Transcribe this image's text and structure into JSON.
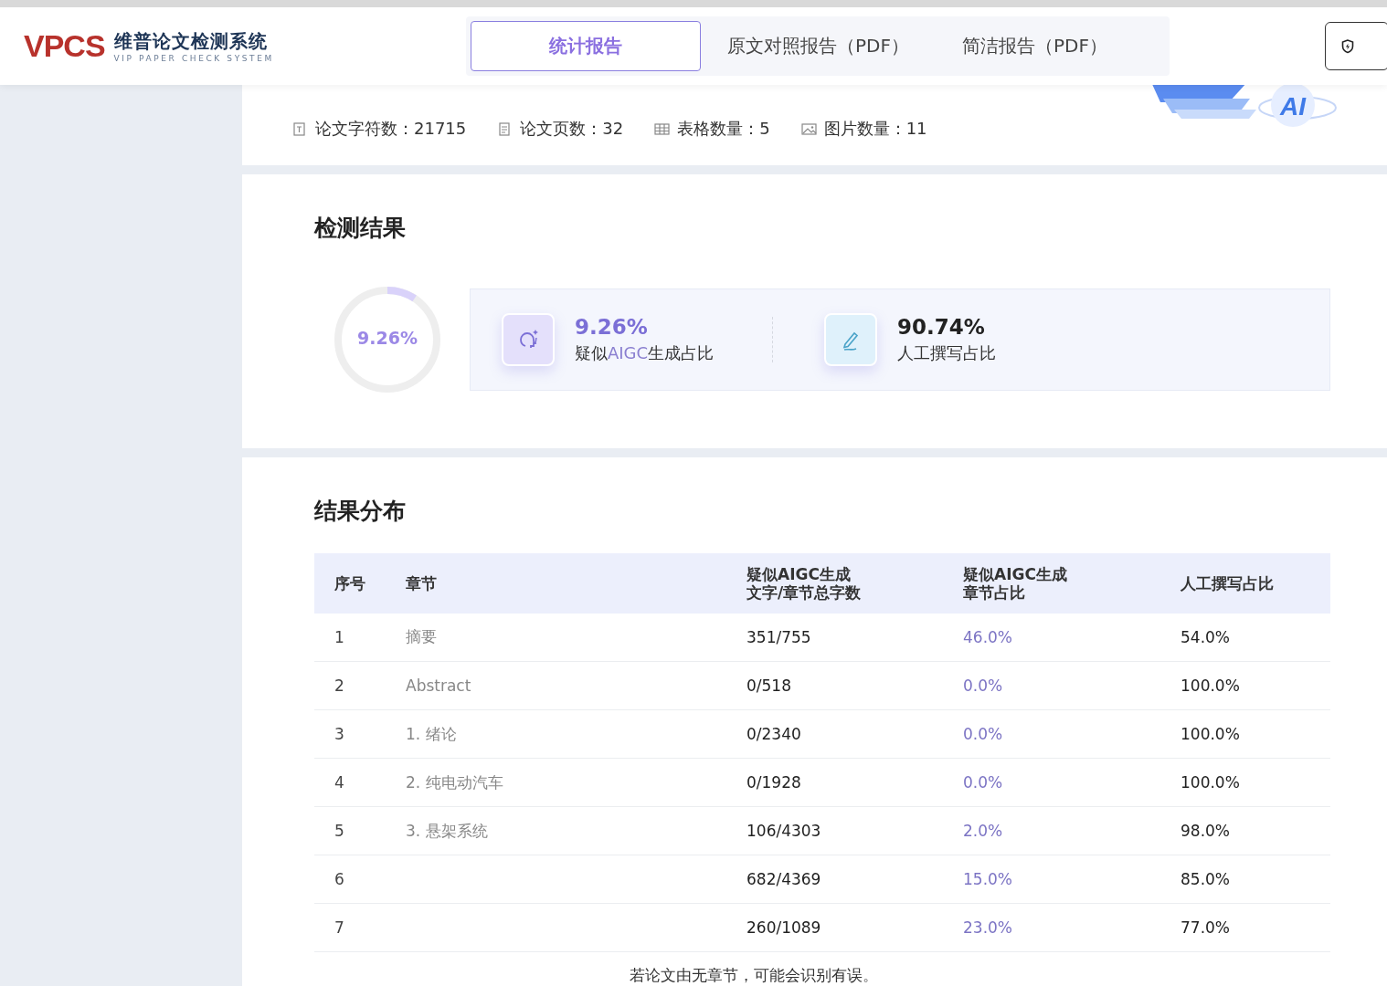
{
  "header": {
    "logo_mark": "VPCS",
    "logo_title": "维普论文检测系统",
    "logo_subtitle": "VIP PAPER CHECK SYSTEM",
    "tabs": [
      {
        "label": "统计报告",
        "selected": true
      },
      {
        "label": "原文对照报告（PDF）",
        "selected": false
      },
      {
        "label": "简洁报告（PDF）",
        "selected": false
      }
    ]
  },
  "paper_info": {
    "stats": [
      {
        "kind": "chars",
        "label": "论文字符数：",
        "value": "21715"
      },
      {
        "kind": "pages",
        "label": "论文页数：",
        "value": "32"
      },
      {
        "kind": "tables",
        "label": "表格数量：",
        "value": "5"
      },
      {
        "kind": "images",
        "label": "图片数量：",
        "value": "11"
      }
    ],
    "illustration_label": "AI"
  },
  "detection": {
    "title": "检测结果",
    "donut": {
      "label": "9.26%",
      "level": 0.0926
    },
    "metrics": [
      {
        "kind": "aigc",
        "value": "9.26%",
        "label": "疑似**AIGC**生成占比"
      },
      {
        "kind": "human",
        "value": "90.74%",
        "label": "人工撰写占比"
      }
    ]
  },
  "distribution": {
    "title": "结果分布",
    "columns": [
      {
        "lines": [
          "序号"
        ]
      },
      {
        "lines": [
          "章节"
        ]
      },
      {
        "lines": [
          "疑似AIGC生成",
          "文字/章节总字数"
        ]
      },
      {
        "lines": [
          "疑似AIGC生成",
          "章节占比"
        ]
      },
      {
        "lines": [
          "人工撰写占比"
        ]
      }
    ],
    "rows": [
      {
        "index": "1",
        "chapter": "摘要",
        "ratio": "351/755",
        "aigc": "46.0%",
        "human": "54.0%"
      },
      {
        "index": "2",
        "chapter": "Abstract",
        "ratio": "0/518",
        "aigc": "0.0%",
        "human": "100.0%"
      },
      {
        "index": "3",
        "chapter": "1. 绪论",
        "ratio": "0/2340",
        "aigc": "0.0%",
        "human": "100.0%"
      },
      {
        "index": "4",
        "chapter": "2. 纯电动汽车",
        "ratio": "0/1928",
        "aigc": "0.0%",
        "human": "100.0%"
      },
      {
        "index": "5",
        "chapter": "3. 悬架系统",
        "ratio": "106/4303",
        "aigc": "2.0%",
        "human": "98.0%"
      },
      {
        "index": "6",
        "ratio": "682/4369",
        "aigc": "15.0%",
        "human": "85.0%"
      },
      {
        "index": "7",
        "ratio": "260/1089",
        "aigc": "23.0%",
        "human": "77.0%"
      }
    ],
    "note": "若论文由无章节，可能会识别有误。"
  }
}
